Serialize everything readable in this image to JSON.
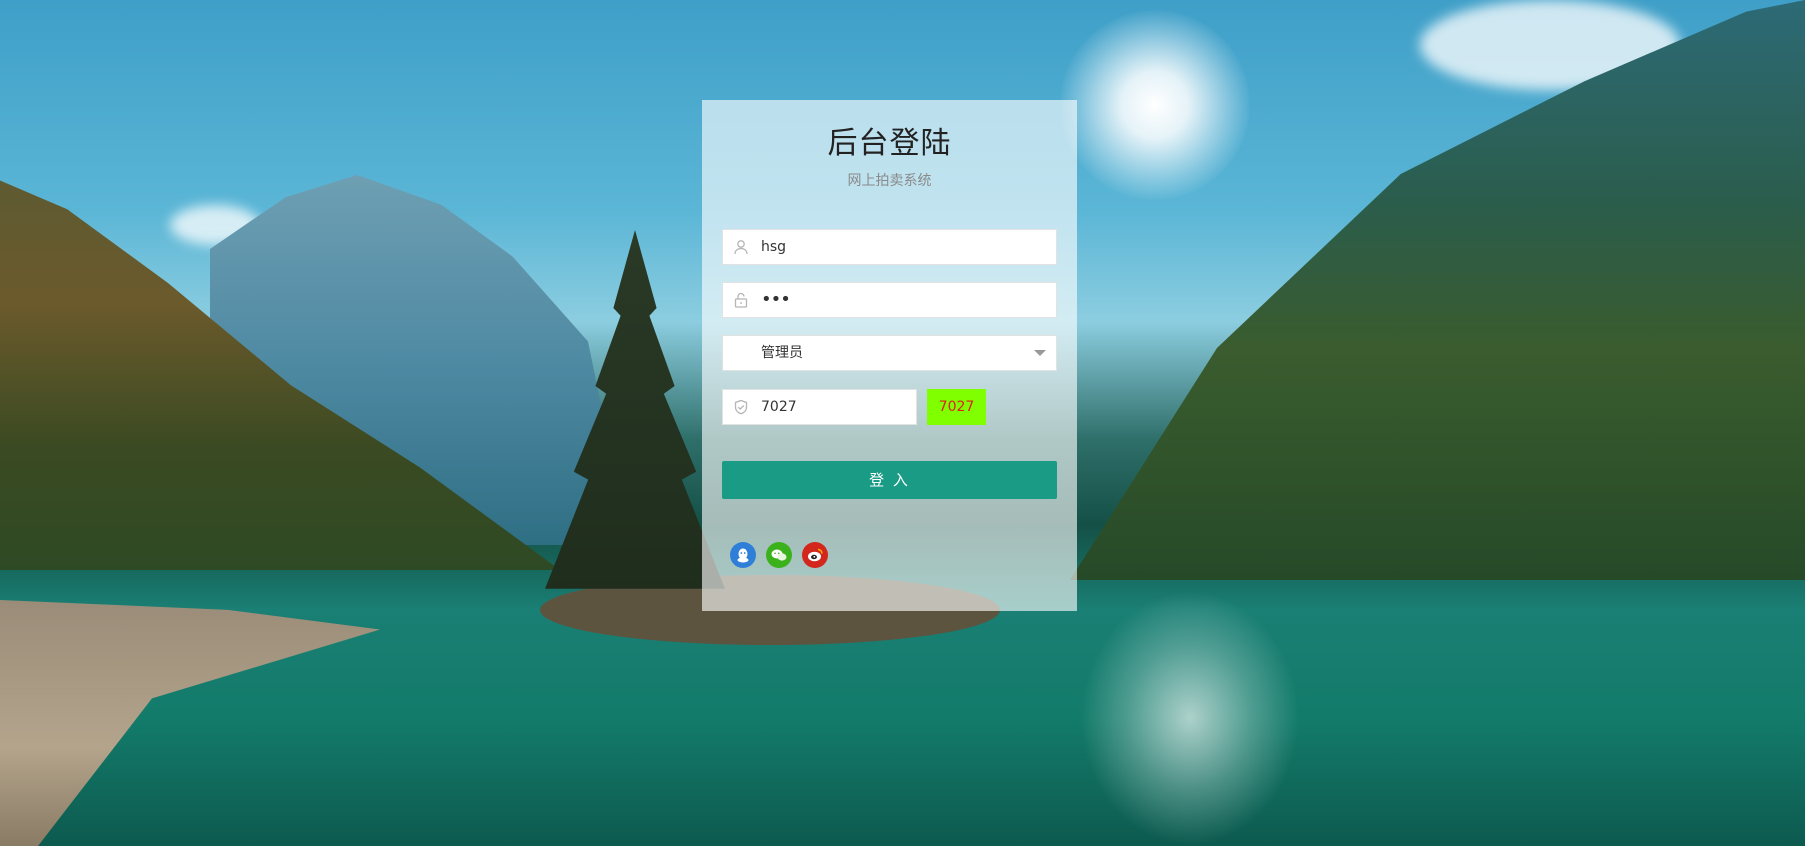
{
  "login": {
    "title": "后台登陆",
    "subtitle": "网上拍卖系统",
    "username": {
      "value": "hsg",
      "icon": "user-icon"
    },
    "password": {
      "value": "•••",
      "icon": "lock-icon"
    },
    "role": {
      "selected": "管理员",
      "icon": "chevron-down-icon"
    },
    "captcha": {
      "value": "7027",
      "image_text": "7027",
      "icon": "shield-icon",
      "image_bg": "#7fff00",
      "image_color": "#e0201a"
    },
    "submit_label": "登 入",
    "submit_color": "#199b85",
    "social": [
      {
        "name": "qq-icon",
        "color": "#2f7fd8"
      },
      {
        "name": "wechat-icon",
        "color": "#3bb21c"
      },
      {
        "name": "weibo-icon",
        "color": "#d3261c"
      }
    ]
  }
}
